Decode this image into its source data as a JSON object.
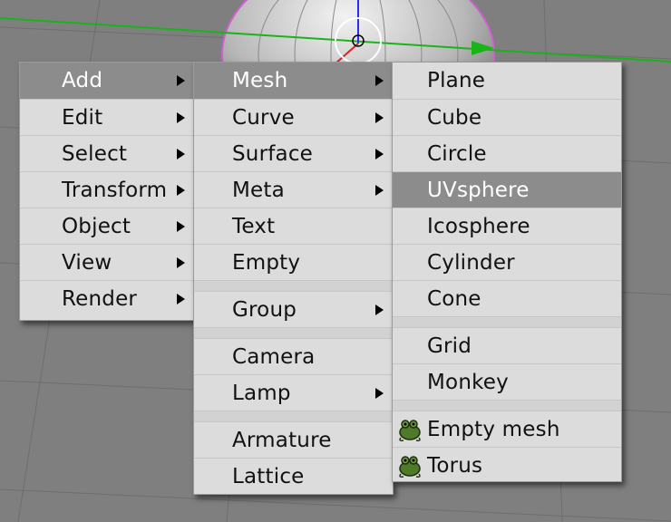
{
  "menu_main": {
    "items": [
      {
        "label": "Add"
      },
      {
        "label": "Edit"
      },
      {
        "label": "Select"
      },
      {
        "label": "Transform"
      },
      {
        "label": "Object"
      },
      {
        "label": "View"
      },
      {
        "label": "Render"
      }
    ]
  },
  "menu_add": {
    "items": [
      {
        "label": "Mesh"
      },
      {
        "label": "Curve"
      },
      {
        "label": "Surface"
      },
      {
        "label": "Meta"
      },
      {
        "label": "Text"
      },
      {
        "label": "Empty"
      },
      {
        "label": "Group"
      },
      {
        "label": "Camera"
      },
      {
        "label": "Lamp"
      },
      {
        "label": "Armature"
      },
      {
        "label": "Lattice"
      }
    ]
  },
  "menu_mesh": {
    "items": [
      {
        "label": "Plane"
      },
      {
        "label": "Cube"
      },
      {
        "label": "Circle"
      },
      {
        "label": "UVsphere"
      },
      {
        "label": "Icosphere"
      },
      {
        "label": "Cylinder"
      },
      {
        "label": "Cone"
      },
      {
        "label": "Grid"
      },
      {
        "label": "Monkey"
      },
      {
        "label": "Empty mesh",
        "icon": "python-script-icon"
      },
      {
        "label": "Torus",
        "icon": "python-script-icon"
      }
    ]
  },
  "colors": {
    "menu_bg": "#dcdcdc",
    "highlight": "#8c8c8c",
    "viewport_bg": "#7f7f7f",
    "x_axis": "#19b419"
  }
}
